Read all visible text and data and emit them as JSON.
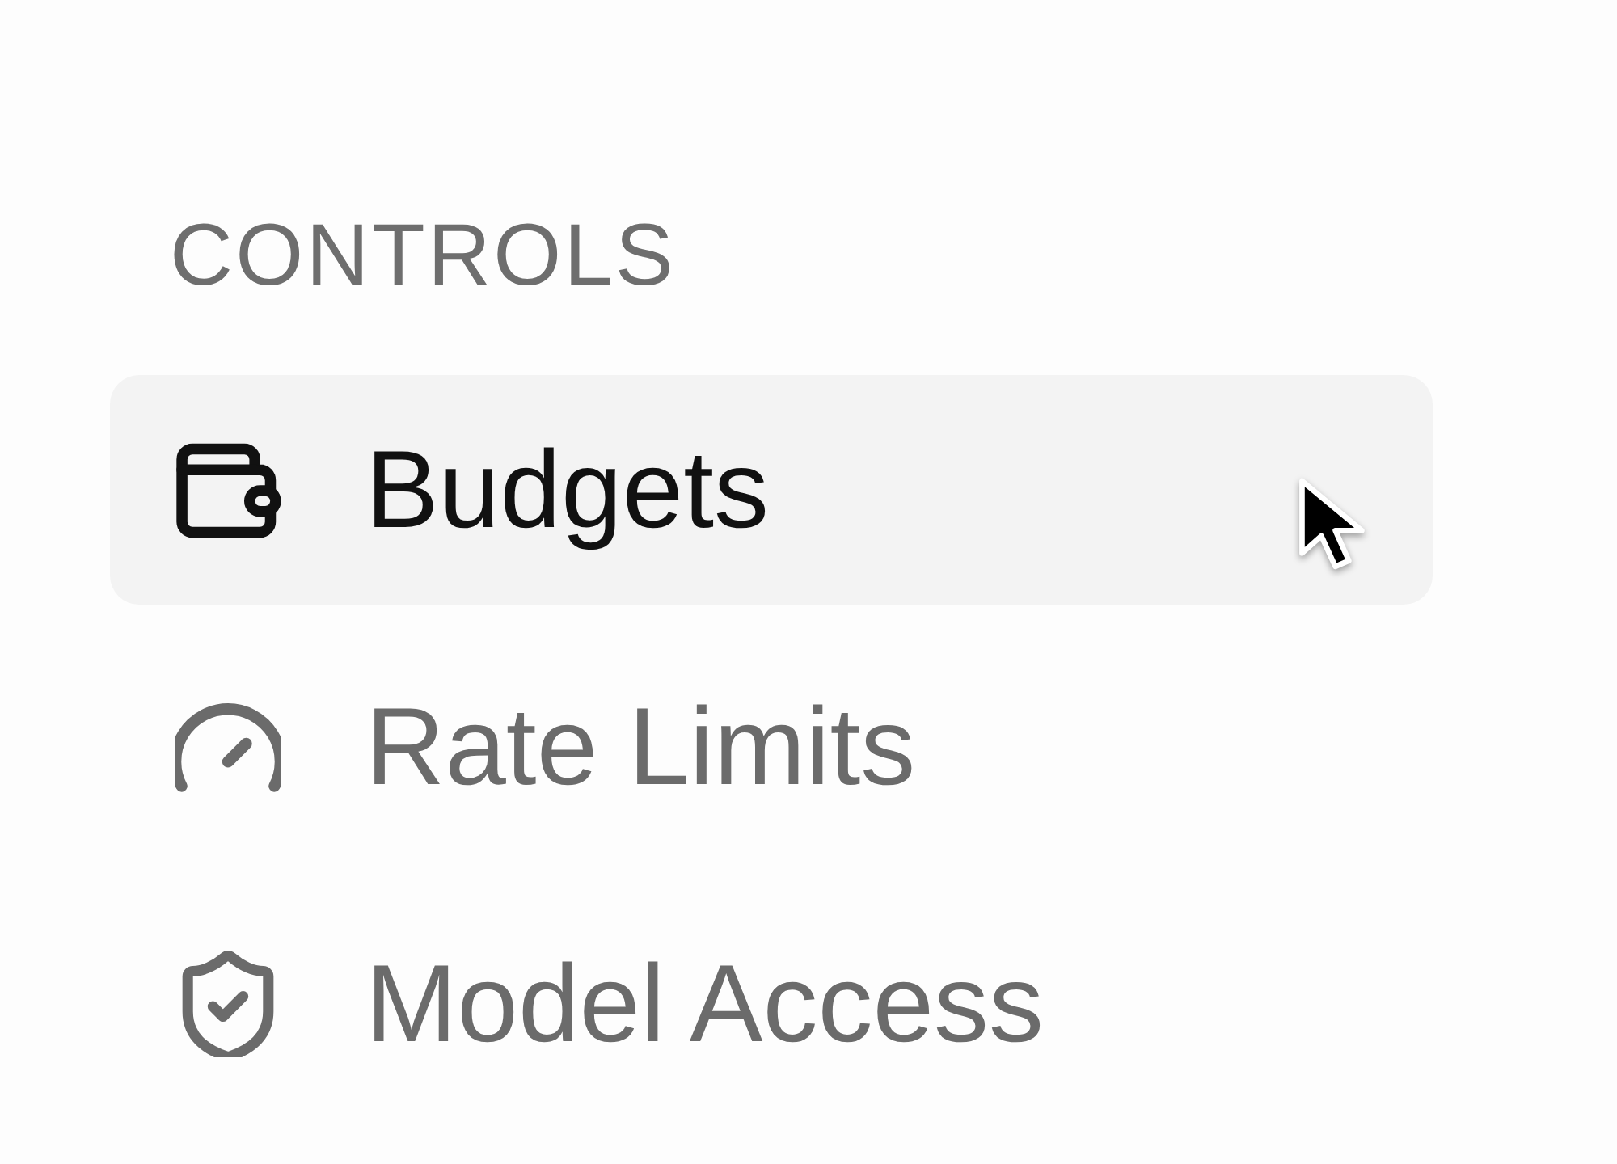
{
  "section": {
    "heading": "CONTROLS",
    "items": [
      {
        "label": "Budgets",
        "selected": true
      },
      {
        "label": "Rate Limits",
        "selected": false
      },
      {
        "label": "Model Access",
        "selected": false
      }
    ]
  }
}
